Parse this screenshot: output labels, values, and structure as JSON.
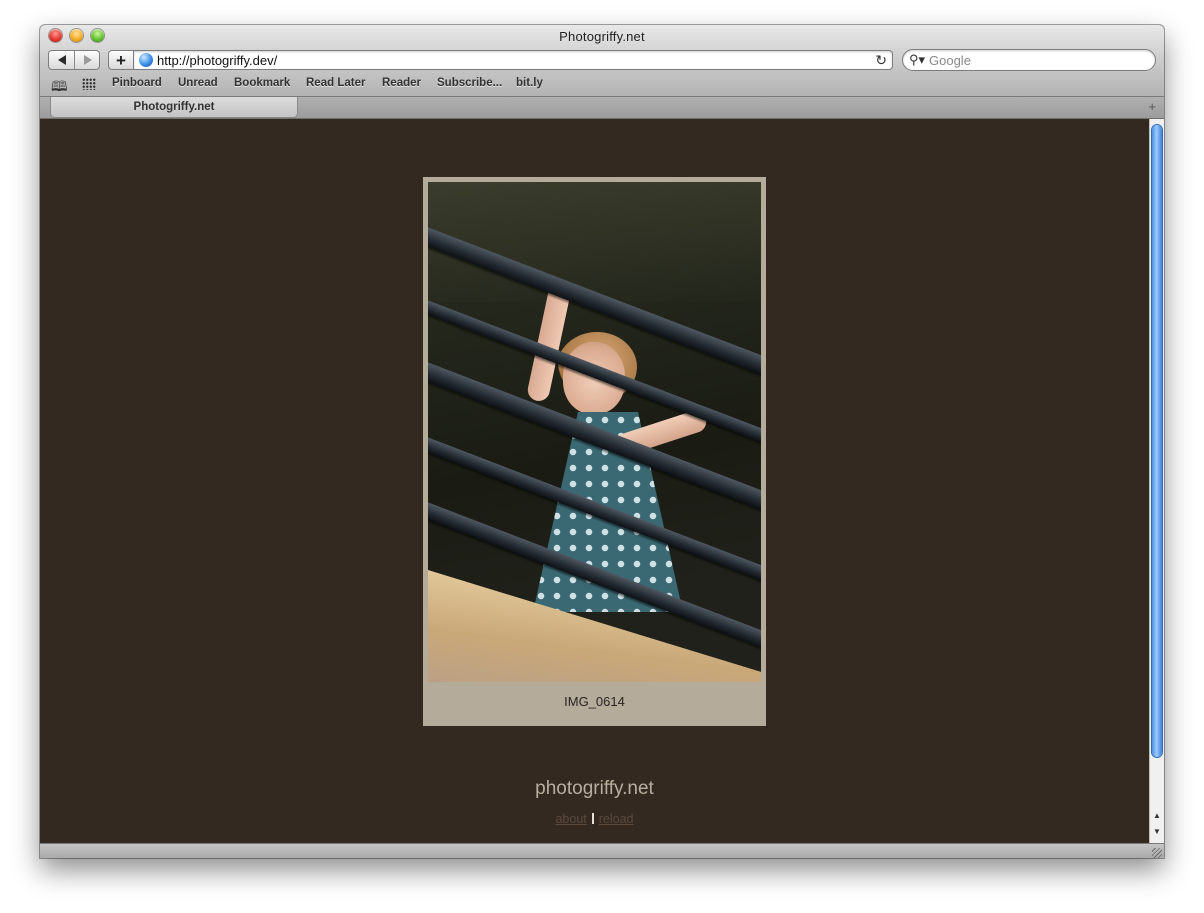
{
  "window": {
    "title": "Photogriffy.net"
  },
  "toolbar": {
    "url": "http://photogriffy.dev/",
    "add_label": "+",
    "reload_glyph": "↻",
    "search_placeholder": "Google"
  },
  "bookmarks": [
    "Pinboard",
    "Unread",
    "Bookmark",
    "Read Later",
    "Reader",
    "Subscribe...",
    "bit.ly"
  ],
  "tabs": [
    {
      "label": "Photogriffy.net"
    }
  ],
  "page": {
    "photo_caption": "IMG_0614",
    "site_name": "photogriffy.net",
    "links": {
      "about": "about",
      "reload": "reload"
    }
  },
  "colors": {
    "page_background": "#342921",
    "frame": "#b5ab9b",
    "scroll_accent": "#4a8fe0"
  }
}
